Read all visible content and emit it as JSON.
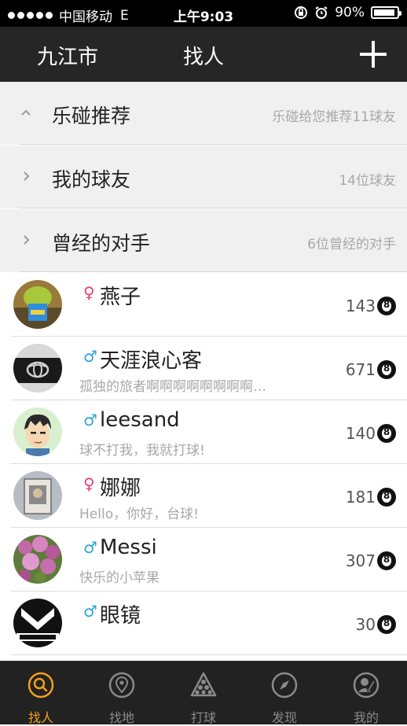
{
  "status_bar": {
    "carrier": "中国移动",
    "network": "E",
    "time": "上午9:03",
    "battery": "90%"
  },
  "navbar": {
    "city": "九江市",
    "title": "找人"
  },
  "groups": [
    {
      "label": "乐碰推荐",
      "summary": "乐碰给您推荐11球友",
      "expanded": true
    },
    {
      "label": "我的球友",
      "summary": "14位球友",
      "expanded": false
    },
    {
      "label": "曾经的对手",
      "summary": "6位曾经的对手",
      "expanded": false
    }
  ],
  "friends": [
    {
      "name": "燕子",
      "gender": "♀",
      "bio": "",
      "score": "143",
      "ball": "8"
    },
    {
      "name": "天涯浪心客",
      "gender": "♂",
      "bio": "孤独的旅者啊啊啊啊啊啊啊啊…",
      "score": "671",
      "ball": "8"
    },
    {
      "name": "leesand",
      "gender": "♂",
      "bio": "球不打我，我就打球!",
      "score": "140",
      "ball": "8"
    },
    {
      "name": "娜娜",
      "gender": "♀",
      "bio": "Hello，你好，台球!",
      "score": "181",
      "ball": "8"
    },
    {
      "name": "Messi",
      "gender": "♂",
      "bio": "快乐的小苹果",
      "score": "307",
      "ball": "8"
    },
    {
      "name": "眼镜",
      "gender": "♂",
      "bio": "",
      "score": "30",
      "ball": "8"
    }
  ],
  "tabs": [
    {
      "label": "找人",
      "icon": "search-icon",
      "active": true
    },
    {
      "label": "找地",
      "icon": "location-pin-icon",
      "active": false
    },
    {
      "label": "打球",
      "icon": "billiard-rack-icon",
      "active": false
    },
    {
      "label": "发现",
      "icon": "compass-icon",
      "active": false
    },
    {
      "label": "我的",
      "icon": "profile-icon",
      "active": false
    }
  ],
  "colors": {
    "accent": "#f2a01e",
    "male": "#2aa5d8",
    "female": "#e83d72",
    "navbar_bg": "#262626",
    "tabbar_bg": "#222222"
  }
}
